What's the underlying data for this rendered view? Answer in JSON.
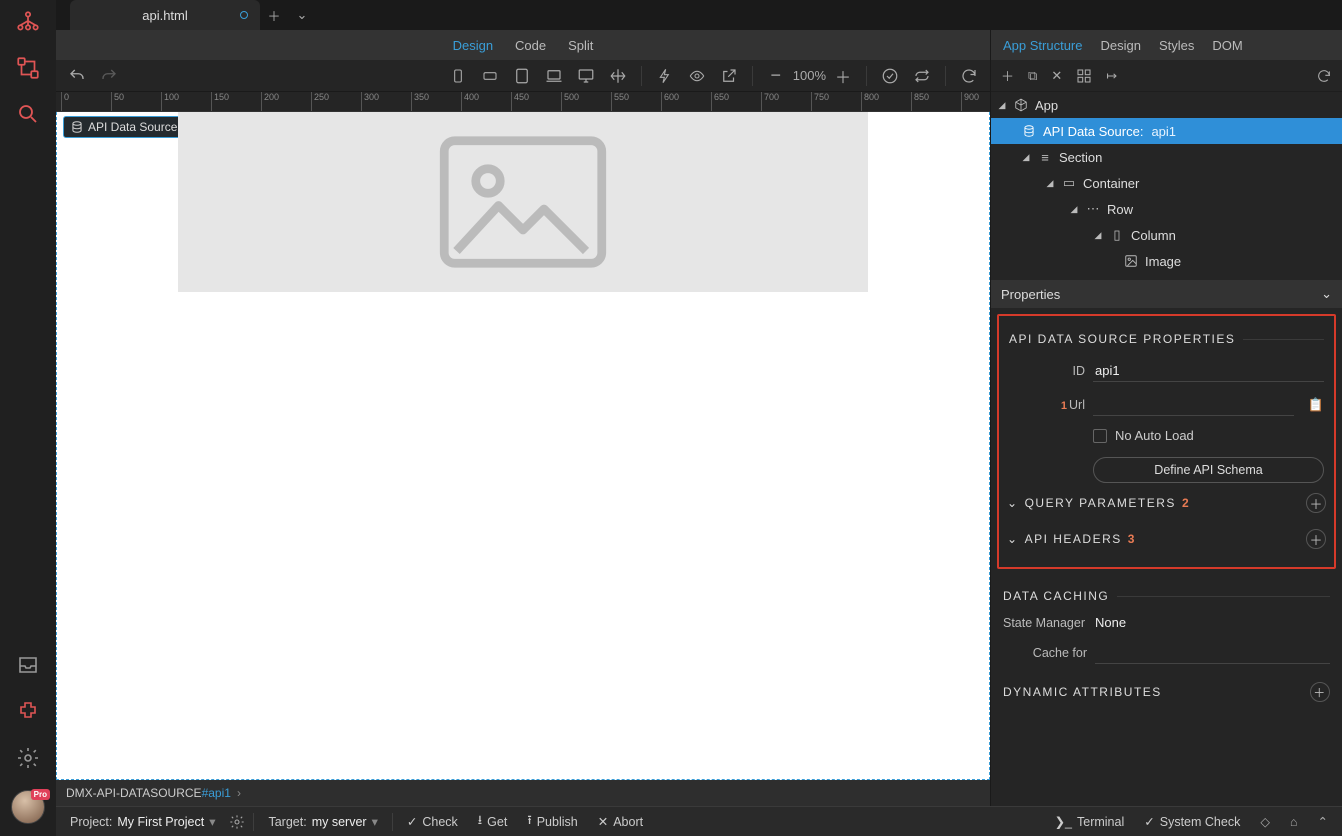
{
  "tab": {
    "filename": "api.html"
  },
  "viewmodes": {
    "design": "Design",
    "code": "Code",
    "split": "Split"
  },
  "zoom": "100%",
  "ruler_marks": [
    0,
    50,
    100,
    150,
    200,
    250,
    300,
    350,
    400,
    450,
    500,
    550,
    600,
    650,
    700,
    750,
    800,
    850,
    900
  ],
  "selection": {
    "label": "API Data Source:",
    "id": "api1"
  },
  "breadcrumb": {
    "base": "DMX-API-DATASOURCE",
    "suffix": "#api1"
  },
  "status": {
    "project_lbl": "Project:",
    "project_val": "My First Project",
    "target_lbl": "Target:",
    "target_val": "my server",
    "check": "Check",
    "get": "Get",
    "publish": "Publish",
    "abort": "Abort",
    "terminal": "Terminal",
    "syscheck": "System Check"
  },
  "right_tabs": {
    "appstruct": "App Structure",
    "styles": "Styles",
    "design": "Design",
    "dom": "DOM"
  },
  "tree": {
    "app": "App",
    "api": {
      "label": "API Data Source:",
      "id": "api1"
    },
    "section": "Section",
    "container": "Container",
    "row": "Row",
    "column": "Column",
    "image": "Image"
  },
  "properties_label": "Properties",
  "props": {
    "title": "API DATA SOURCE PROPERTIES",
    "id_lbl": "ID",
    "id_val": "api1",
    "url_lbl": "Url",
    "url_num": "1",
    "url_val": "",
    "noauto": "No Auto Load",
    "schema_btn": "Define API Schema",
    "qparams": "QUERY PARAMETERS",
    "qparams_num": "2",
    "headers": "API HEADERS",
    "headers_num": "3"
  },
  "caching": {
    "title": "DATA CACHING",
    "sm_lbl": "State Manager",
    "sm_val": "None",
    "cache_lbl": "Cache for",
    "cache_val": ""
  },
  "dynattr": "DYNAMIC ATTRIBUTES",
  "avatar_badge": "Pro"
}
